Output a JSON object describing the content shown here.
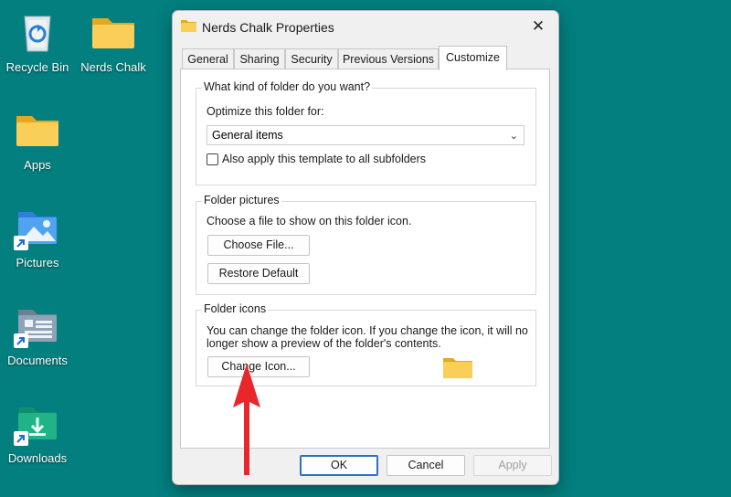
{
  "desktop": {
    "icons": [
      {
        "label": "Recycle Bin"
      },
      {
        "label": "Nerds Chalk"
      },
      {
        "label": "Apps"
      },
      {
        "label": "Pictures"
      },
      {
        "label": "Documents"
      },
      {
        "label": "Downloads"
      }
    ]
  },
  "dialog": {
    "title": "Nerds Chalk Properties",
    "close_symbol": "✕",
    "tabs": [
      {
        "label": "General"
      },
      {
        "label": "Sharing"
      },
      {
        "label": "Security"
      },
      {
        "label": "Previous Versions"
      },
      {
        "label": "Customize",
        "active": true
      }
    ],
    "folder_type_group": {
      "title": "What kind of folder do you want?",
      "optimize_label": "Optimize this folder for:",
      "selected_option": "General items",
      "apply_subfolders_label": "Also apply this template to all subfolders",
      "apply_subfolders_checked": false
    },
    "folder_pictures_group": {
      "title": "Folder pictures",
      "description": "Choose a file to show on this folder icon.",
      "choose_file_label": "Choose File...",
      "restore_default_label": "Restore Default"
    },
    "folder_icons_group": {
      "title": "Folder icons",
      "description_line1": "You can change the folder icon. If you change the icon, it will no",
      "description_line2": "longer show a preview of the folder's contents.",
      "change_icon_label": "Change Icon..."
    },
    "footer": {
      "ok_label": "OK",
      "cancel_label": "Cancel",
      "apply_label": "Apply"
    }
  },
  "colors": {
    "desktop_background": "#037f7f",
    "annotation_arrow": "#e8262b",
    "folder_yellow": "#f7c948"
  }
}
